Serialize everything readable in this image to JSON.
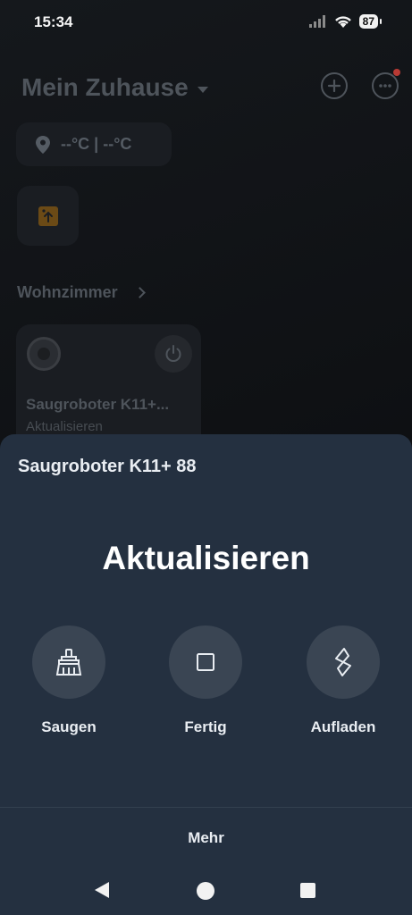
{
  "status_bar": {
    "time": "15:34",
    "battery": "87"
  },
  "home": {
    "title": "Mein Zuhause",
    "weather": "--°C | --°C",
    "room": "Wohnzimmer",
    "device_card": {
      "name": "Saugroboter K11+...",
      "status": "Aktualisieren"
    }
  },
  "sheet": {
    "device_name": "Saugroboter K11+ 88",
    "status": "Aktualisieren",
    "actions": [
      {
        "label": "Saugen",
        "icon": "broom-icon"
      },
      {
        "label": "Fertig",
        "icon": "stop-icon"
      },
      {
        "label": "Aufladen",
        "icon": "charge-icon"
      }
    ],
    "more_label": "Mehr"
  },
  "colors": {
    "sheet_bg": "#243040",
    "action_bg": "#3a4553",
    "notification_dot": "#b83a34",
    "scene_icon": "#6b4a16"
  }
}
